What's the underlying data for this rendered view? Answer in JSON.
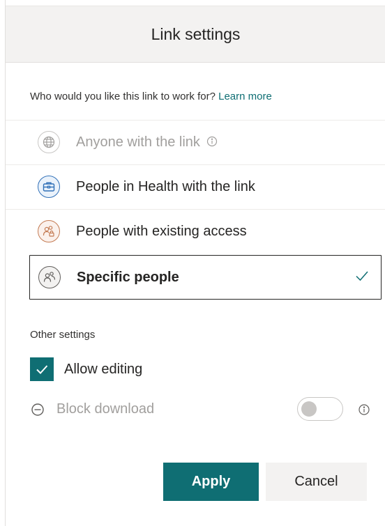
{
  "header": {
    "title": "Link settings"
  },
  "question": {
    "text": "Who would you like this link to work for?",
    "learn_more": "Learn more"
  },
  "options": [
    {
      "label": "Anyone with the link",
      "icon": "globe-icon",
      "state": "disabled"
    },
    {
      "label": "People in Health with the link",
      "icon": "briefcase-icon"
    },
    {
      "label": "People with existing access",
      "icon": "people-lock-icon"
    },
    {
      "label": "Specific people",
      "icon": "people-icon",
      "selected": true
    }
  ],
  "other_settings": {
    "heading": "Other settings",
    "allow_editing": {
      "label": "Allow editing",
      "checked": true
    },
    "block_download": {
      "label": "Block download",
      "enabled": false,
      "toggle_on": false
    }
  },
  "buttons": {
    "apply": "Apply",
    "cancel": "Cancel"
  },
  "colors": {
    "accent": "#0f6e73",
    "header_bg": "#f3f2f1",
    "disabled_text": "#a19f9d"
  }
}
